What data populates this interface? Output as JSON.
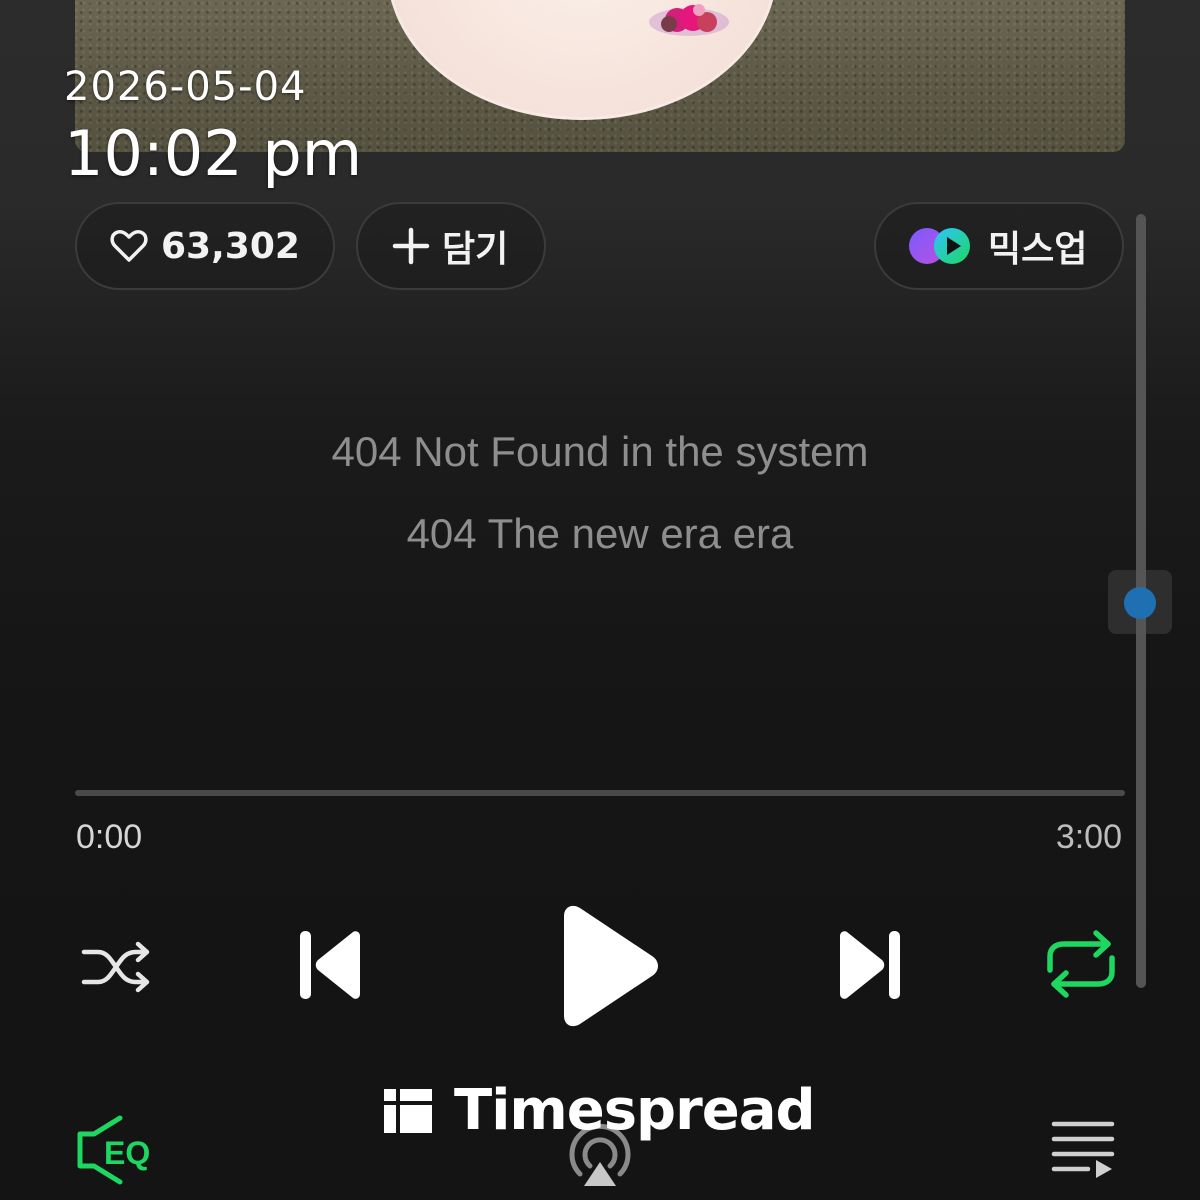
{
  "clock": {
    "date": "2026-05-04",
    "time": "10:02 pm"
  },
  "actions": {
    "like_count": "63,302",
    "add_label": "담기",
    "mixup_label": "믹스업"
  },
  "lyrics": [
    "404 Not Found in the system",
    "404 The new era era"
  ],
  "playback": {
    "current_time": "0:00",
    "total_time": "3:00",
    "progress": 0,
    "repeat_active": true
  },
  "controls": {
    "icons": [
      "shuffle-icon",
      "previous-icon",
      "play-icon",
      "next-icon",
      "repeat-icon"
    ]
  },
  "bottom_bar": {
    "eq_label": "EQ",
    "icons": [
      "eq-icon",
      "airplay-icon",
      "playlist-icon"
    ]
  },
  "watermark": {
    "text": "Timespread"
  },
  "colors": {
    "accent_green": "#1ED760",
    "scroll_thumb": "#1F6FB3",
    "text_muted": "#8E8E8E"
  }
}
